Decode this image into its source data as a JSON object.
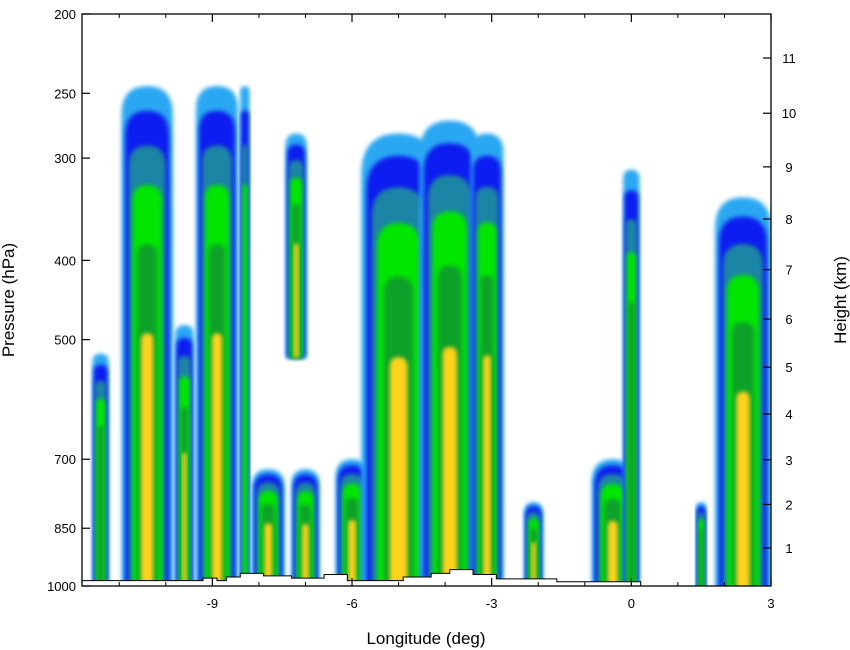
{
  "chart_data": {
    "type": "heatmap",
    "subtype": "filled contour vertical cross-section",
    "title": "",
    "xlabel": "Longitude (deg)",
    "ylabel_left": "Pressure (hPa)",
    "ylabel_right": "Height (km)",
    "xlim": [
      -11.8,
      3
    ],
    "ylim_pressure": [
      1000,
      200
    ],
    "y_scale": "log",
    "x_ticks": [
      -9,
      -6,
      -3,
      0,
      3
    ],
    "x_tick_labels": [
      "-9",
      "-6",
      "-3",
      "0",
      "3"
    ],
    "pressure_ticks": [
      1000,
      850,
      700,
      500,
      400,
      300,
      250,
      200
    ],
    "pressure_tick_labels": [
      "1000",
      "850",
      "700",
      "500",
      "400",
      "300",
      "250",
      "200"
    ],
    "height_ticks": [
      1,
      2,
      3,
      4,
      5,
      6,
      7,
      8,
      9,
      10,
      11
    ],
    "height_tick_labels": [
      "1",
      "2",
      "3",
      "4",
      "5",
      "6",
      "7",
      "8",
      "9",
      "10",
      "11"
    ],
    "contour_colors": [
      "#2aa7f2",
      "#0a1ef0",
      "#1c84a4",
      "#00e600",
      "#0fa12a",
      "#ffd21c"
    ],
    "grid": false,
    "legend": "none",
    "terrain_color": "#ffffff",
    "terrain": [
      {
        "x": -11.8,
        "p": 985
      },
      {
        "x": -9.2,
        "p": 985
      },
      {
        "x": -9.2,
        "p": 978
      },
      {
        "x": -8.9,
        "p": 978
      },
      {
        "x": -8.9,
        "p": 985
      },
      {
        "x": -8.7,
        "p": 985
      },
      {
        "x": -8.7,
        "p": 975
      },
      {
        "x": -8.4,
        "p": 975
      },
      {
        "x": -8.4,
        "p": 965
      },
      {
        "x": -7.9,
        "p": 965
      },
      {
        "x": -7.9,
        "p": 972
      },
      {
        "x": -7.3,
        "p": 972
      },
      {
        "x": -7.3,
        "p": 978
      },
      {
        "x": -6.6,
        "p": 978
      },
      {
        "x": -6.6,
        "p": 968
      },
      {
        "x": -6.1,
        "p": 968
      },
      {
        "x": -6.1,
        "p": 985
      },
      {
        "x": -4.9,
        "p": 985
      },
      {
        "x": -4.9,
        "p": 975
      },
      {
        "x": -4.3,
        "p": 975
      },
      {
        "x": -4.3,
        "p": 965
      },
      {
        "x": -3.9,
        "p": 965
      },
      {
        "x": -3.9,
        "p": 955
      },
      {
        "x": -3.4,
        "p": 955
      },
      {
        "x": -3.4,
        "p": 968
      },
      {
        "x": -2.9,
        "p": 968
      },
      {
        "x": -2.9,
        "p": 980
      },
      {
        "x": -1.6,
        "p": 980
      },
      {
        "x": -1.6,
        "p": 988
      },
      {
        "x": 0.2,
        "p": 988
      },
      {
        "x": 0.2,
        "p": 1000
      }
    ],
    "features": [
      {
        "x": -11.4,
        "top": 520,
        "base": 980,
        "width": 0.35
      },
      {
        "x": -10.4,
        "top": 245,
        "base": 985,
        "width": 1.1
      },
      {
        "x": -9.6,
        "top": 480,
        "base": 985,
        "width": 0.4
      },
      {
        "x": -8.9,
        "top": 245,
        "base": 985,
        "width": 0.9
      },
      {
        "x": -8.3,
        "top": 245,
        "base": 975,
        "width": 0.2
      },
      {
        "x": -7.8,
        "top": 720,
        "base": 975,
        "width": 0.7
      },
      {
        "x": -7.2,
        "top": 280,
        "base": 520,
        "width": 0.45
      },
      {
        "x": -7.0,
        "top": 720,
        "base": 980,
        "width": 0.6
      },
      {
        "x": -6.0,
        "top": 700,
        "base": 985,
        "width": 0.7
      },
      {
        "x": -5.0,
        "top": 280,
        "base": 985,
        "width": 1.6
      },
      {
        "x": -3.9,
        "top": 270,
        "base": 965,
        "width": 1.3
      },
      {
        "x": -3.1,
        "top": 280,
        "base": 975,
        "width": 0.7
      },
      {
        "x": -2.1,
        "top": 790,
        "base": 990,
        "width": 0.4
      },
      {
        "x": -0.4,
        "top": 700,
        "base": 990,
        "width": 0.9
      },
      {
        "x": 0.0,
        "top": 310,
        "base": 990,
        "width": 0.35
      },
      {
        "x": 1.5,
        "top": 790,
        "base": 1000,
        "width": 0.22
      },
      {
        "x": 2.4,
        "top": 335,
        "base": 1000,
        "width": 1.2
      }
    ]
  }
}
